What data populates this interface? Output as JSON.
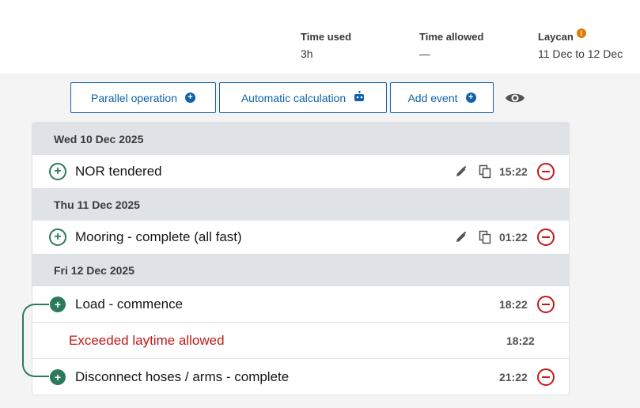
{
  "stats": {
    "time_used_label": "Time used",
    "time_used_value": "3h",
    "time_allowed_label": "Time allowed",
    "time_allowed_value": "—",
    "laycan_label": "Laycan",
    "laycan_value": "11 Dec to 12 Dec"
  },
  "toolbar": {
    "parallel_label": "Parallel operation",
    "auto_calc_label": "Automatic calculation",
    "add_event_label": "Add event"
  },
  "days": [
    {
      "date": "Wed 10 Dec 2025"
    },
    {
      "date": "Thu 11 Dec 2025"
    },
    {
      "date": "Fri 12 Dec 2025"
    }
  ],
  "events": [
    {
      "name": "NOR tendered",
      "time": "15:22"
    },
    {
      "name": "Mooring - complete (all fast)",
      "time": "01:22"
    },
    {
      "name": "Load - commence",
      "time": "18:22"
    },
    {
      "name": "Disconnect hoses / arms - complete",
      "time": "21:22"
    }
  ],
  "warning": {
    "text": "Exceeded laytime allowed",
    "time": "18:22"
  },
  "colors": {
    "accent": "#0f62a8",
    "green": "#2d7a5a",
    "danger": "#c21818",
    "info": "#e07b00"
  }
}
